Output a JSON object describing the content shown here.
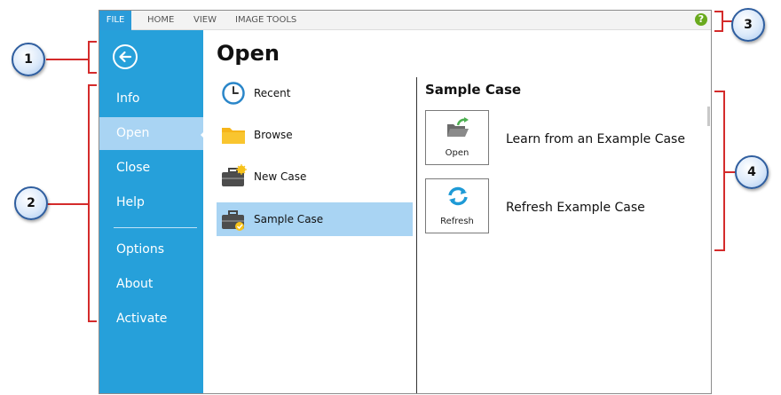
{
  "ribbon": {
    "tabs": [
      "FILE",
      "HOME",
      "VIEW",
      "IMAGE TOOLS"
    ],
    "help_icon": "help-icon",
    "colors": {
      "file_tab": "#2a9bd9",
      "help": "#6aaa1e"
    }
  },
  "sidebar": {
    "back_icon": "back-arrow-icon",
    "items": [
      {
        "label": "Info"
      },
      {
        "label": "Open"
      },
      {
        "label": "Close"
      },
      {
        "label": "Help"
      },
      {
        "label": "Options"
      },
      {
        "label": "About"
      },
      {
        "label": "Activate"
      }
    ],
    "active": "Open",
    "colors": {
      "background": "#26a0da",
      "active": "#a9d4f3"
    }
  },
  "main": {
    "title": "Open",
    "options": [
      {
        "label": "Recent",
        "icon": "clock-icon"
      },
      {
        "label": "Browse",
        "icon": "folder-icon"
      },
      {
        "label": "New Case",
        "icon": "briefcase-new-icon"
      },
      {
        "label": "Sample Case",
        "icon": "briefcase-sample-icon"
      }
    ],
    "selected_option": "Sample Case"
  },
  "panel": {
    "title": "Sample Case",
    "actions": [
      {
        "tile_label": "Open",
        "icon": "open-folder-icon",
        "description": "Learn from an Example Case"
      },
      {
        "tile_label": "Refresh",
        "icon": "refresh-icon",
        "description": "Refresh Example Case"
      }
    ]
  },
  "callouts": [
    "1",
    "2",
    "3",
    "4"
  ],
  "callout_colors": {
    "bracket": "#d42b2b",
    "badge_border": "#2f5e9f"
  }
}
